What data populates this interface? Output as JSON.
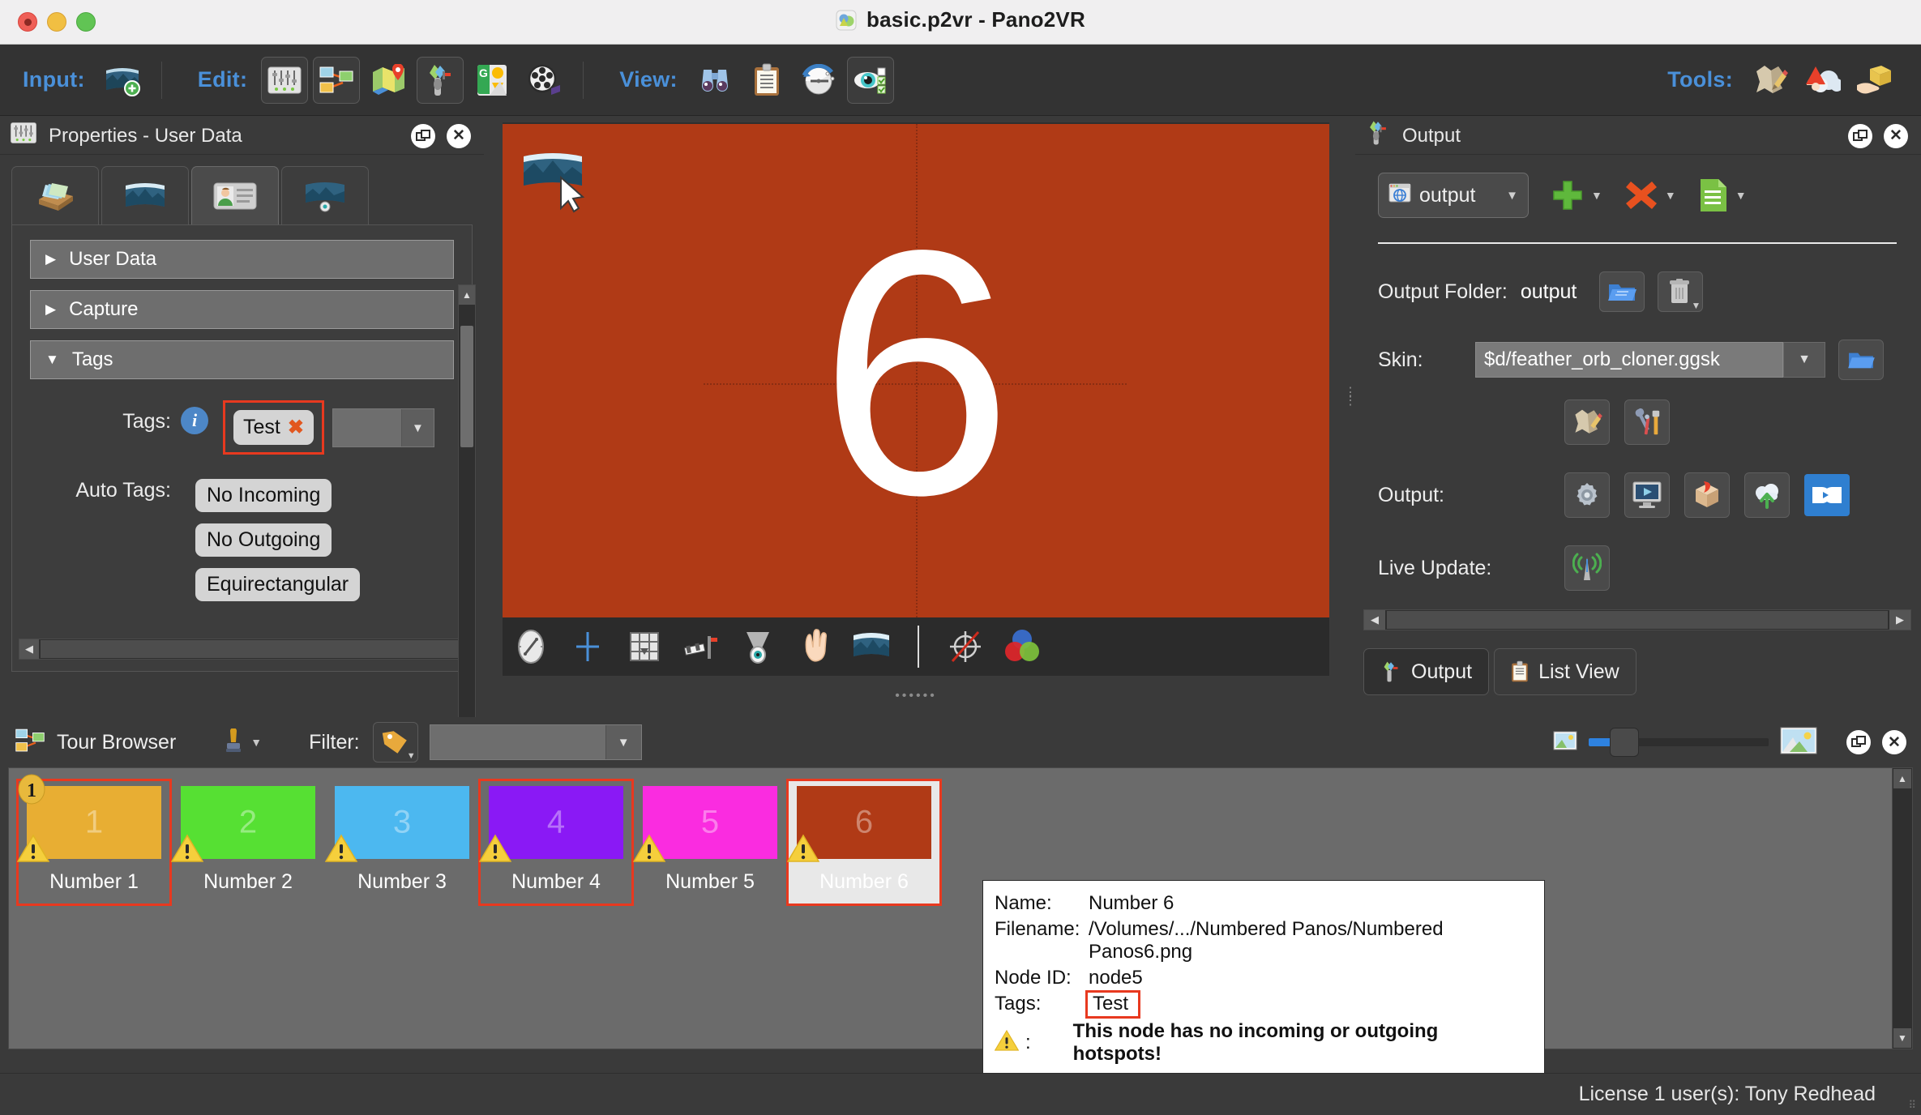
{
  "window": {
    "title": "basic.p2vr - Pano2VR",
    "app_icon": "pano2vr-app-icon",
    "traffic_lights": [
      "close",
      "minimize",
      "zoom"
    ]
  },
  "toolbar": {
    "groups": [
      {
        "label": "Input:",
        "buttons": [
          {
            "name": "add-input-panorama-icon",
            "active": false
          }
        ]
      },
      {
        "label": "Edit:",
        "buttons": [
          {
            "name": "properties-sliders-icon",
            "active": true
          },
          {
            "name": "tour-browser-icon",
            "active": false
          },
          {
            "name": "map-pin-icon",
            "active": false
          },
          {
            "name": "output-feather-icon",
            "active": true
          },
          {
            "name": "google-street-view-icon",
            "active": false
          },
          {
            "name": "film-reel-icon",
            "active": false
          }
        ]
      },
      {
        "label": "View:",
        "buttons": [
          {
            "name": "binoculars-icon",
            "active": false
          },
          {
            "name": "clipboard-icon",
            "active": false
          },
          {
            "name": "compass-icon",
            "active": false
          },
          {
            "name": "eye-visibility-icon",
            "active": true
          }
        ]
      },
      {
        "label": "Tools:",
        "buttons": [
          {
            "name": "skin-editor-icon",
            "active": false
          },
          {
            "name": "gnome-cloud-icon",
            "active": false
          },
          {
            "name": "package-hand-icon",
            "active": false
          }
        ]
      }
    ]
  },
  "properties_panel": {
    "title": "Properties - User Data",
    "title_icon": "properties-sliders-icon",
    "header_buttons": [
      "float-panel-icon",
      "close-panel-icon"
    ],
    "tabs": [
      {
        "name": "tab-input-files",
        "icon": "file-tray-icon",
        "active": false
      },
      {
        "name": "tab-panorama",
        "icon": "panorama-icon",
        "active": false
      },
      {
        "name": "tab-user-data",
        "icon": "id-card-icon",
        "active": true
      },
      {
        "name": "tab-viewing-parameters",
        "icon": "view-panorama-icon",
        "active": false
      }
    ],
    "sections": [
      {
        "label": "User Data",
        "expanded": false
      },
      {
        "label": "Capture",
        "expanded": false
      },
      {
        "label": "Tags",
        "expanded": true
      }
    ],
    "tags": {
      "label": "Tags:",
      "info_icon": "info-icon",
      "chips": [
        {
          "text": "Test",
          "remove_icon": "remove-tag-icon"
        }
      ],
      "combo_value": "",
      "highlighted": true
    },
    "auto_tags": {
      "label": "Auto Tags:",
      "chips": [
        "No Incoming",
        "No Outgoing",
        "Equirectangular"
      ]
    }
  },
  "viewport": {
    "pano_number": "6",
    "background_color": "#b03a16",
    "overlay_icon": "panorama-cursor-icon",
    "toolbar_buttons": [
      {
        "name": "compass-tool-icon"
      },
      {
        "name": "crosshair-tool-icon"
      },
      {
        "name": "grid-tool-icon"
      },
      {
        "name": "hotspot-tool-icon"
      },
      {
        "name": "patch-tool-icon"
      },
      {
        "name": "pan-hand-tool-icon"
      },
      {
        "name": "panorama-view-tool-icon"
      },
      {
        "name": "no-target-tool-icon"
      },
      {
        "name": "color-wheel-tool-icon"
      }
    ]
  },
  "output_panel": {
    "title": "Output",
    "title_icon": "output-feather-icon",
    "header_buttons": [
      "float-panel-icon",
      "close-panel-icon"
    ],
    "preset_combo": {
      "value": "output",
      "icon": "html5-globe-icon"
    },
    "actions": [
      {
        "name": "add-output-button",
        "icon": "add-plus-icon",
        "has_dropdown": true
      },
      {
        "name": "remove-output-button",
        "icon": "remove-x-icon",
        "has_dropdown": true
      },
      {
        "name": "output-log-button",
        "icon": "document-list-icon",
        "has_dropdown": true
      }
    ],
    "output_folder": {
      "label": "Output Folder:",
      "value": "output",
      "buttons": [
        {
          "name": "browse-folder-button",
          "icon": "open-folder-icon"
        },
        {
          "name": "clear-folder-button",
          "icon": "trash-icon",
          "has_dropdown": true
        }
      ]
    },
    "skin": {
      "label": "Skin:",
      "value": "$d/feather_orb_cloner.ggsk",
      "buttons": [
        {
          "name": "browse-skin-button",
          "icon": "open-skin-icon"
        }
      ],
      "extra_buttons": [
        {
          "name": "edit-skin-button",
          "icon": "skin-editor-icon"
        },
        {
          "name": "skin-settings-button",
          "icon": "tools-hammer-icon"
        }
      ]
    },
    "output": {
      "label": "Output:",
      "buttons": [
        {
          "name": "output-settings-button",
          "icon": "gear-icon"
        },
        {
          "name": "preview-output-button",
          "icon": "monitor-play-icon"
        },
        {
          "name": "package-output-button",
          "icon": "package-box-icon"
        },
        {
          "name": "upload-output-button",
          "icon": "cloud-upload-icon"
        },
        {
          "name": "open-browser-button",
          "icon": "plug-connect-icon"
        }
      ]
    },
    "live_update": {
      "label": "Live Update:",
      "buttons": [
        {
          "name": "live-update-button",
          "icon": "broadcast-antenna-icon"
        }
      ]
    },
    "tabs": [
      {
        "name": "tab-output",
        "label": "Output",
        "icon": "output-feather-icon",
        "active": true
      },
      {
        "name": "tab-list-view",
        "label": "List View",
        "icon": "clipboard-icon",
        "active": false
      }
    ]
  },
  "tour_browser": {
    "title": "Tour Browser",
    "title_icon": "tour-browser-icon",
    "stamp_button": {
      "name": "node-marker-button",
      "icon": "map-marker-icon",
      "has_dropdown": true
    },
    "filter": {
      "label": "Filter:",
      "icon": "tag-filter-icon",
      "value": "",
      "placeholder": ""
    },
    "zoom": {
      "small_icon": "small-thumbnail-icon",
      "large_icon": "large-thumbnail-icon",
      "value": 12
    },
    "header_buttons": [
      "float-panel-icon",
      "close-panel-icon"
    ],
    "nodes": [
      {
        "label": "Number 1",
        "number": "1",
        "color": "#e8ae33",
        "selected": true,
        "current": false,
        "warning": true,
        "start_badge": "1"
      },
      {
        "label": "Number 2",
        "number": "2",
        "color": "#56e033",
        "selected": false,
        "current": false,
        "warning": true,
        "start_badge": null
      },
      {
        "label": "Number 3",
        "number": "3",
        "color": "#4cb8f0",
        "selected": false,
        "current": false,
        "warning": true,
        "start_badge": null
      },
      {
        "label": "Number 4",
        "number": "4",
        "color": "#8a19f5",
        "selected": true,
        "current": false,
        "warning": true,
        "start_badge": null
      },
      {
        "label": "Number 5",
        "number": "5",
        "color": "#fa2ce0",
        "selected": false,
        "current": false,
        "warning": true,
        "start_badge": null
      },
      {
        "label": "Number 6",
        "number": "6",
        "color": "#b03a16",
        "selected": true,
        "current": true,
        "warning": true,
        "start_badge": null
      }
    ]
  },
  "tooltip": {
    "rows": [
      {
        "key": "Name:",
        "value": "Number 6",
        "highlight": false
      },
      {
        "key": "Filename:",
        "value": "/Volumes/.../Numbered Panos/Numbered Panos6.png",
        "highlight": false
      },
      {
        "key": "Node ID:",
        "value": "node5",
        "highlight": false
      },
      {
        "key": "Tags:",
        "value": "Test",
        "highlight": true
      }
    ],
    "warning_icon": "warning-triangle-icon",
    "warning_key": ":",
    "warning_message": "This node has no incoming or outgoing hotspots!"
  },
  "statusbar": {
    "text": "License 1 user(s): Tony Redhead"
  },
  "colors": {
    "accent_blue": "#4a90d9",
    "highlight_red": "#e8391f",
    "panel_bg": "#3a3a3a",
    "toolbar_bg": "#333333"
  }
}
